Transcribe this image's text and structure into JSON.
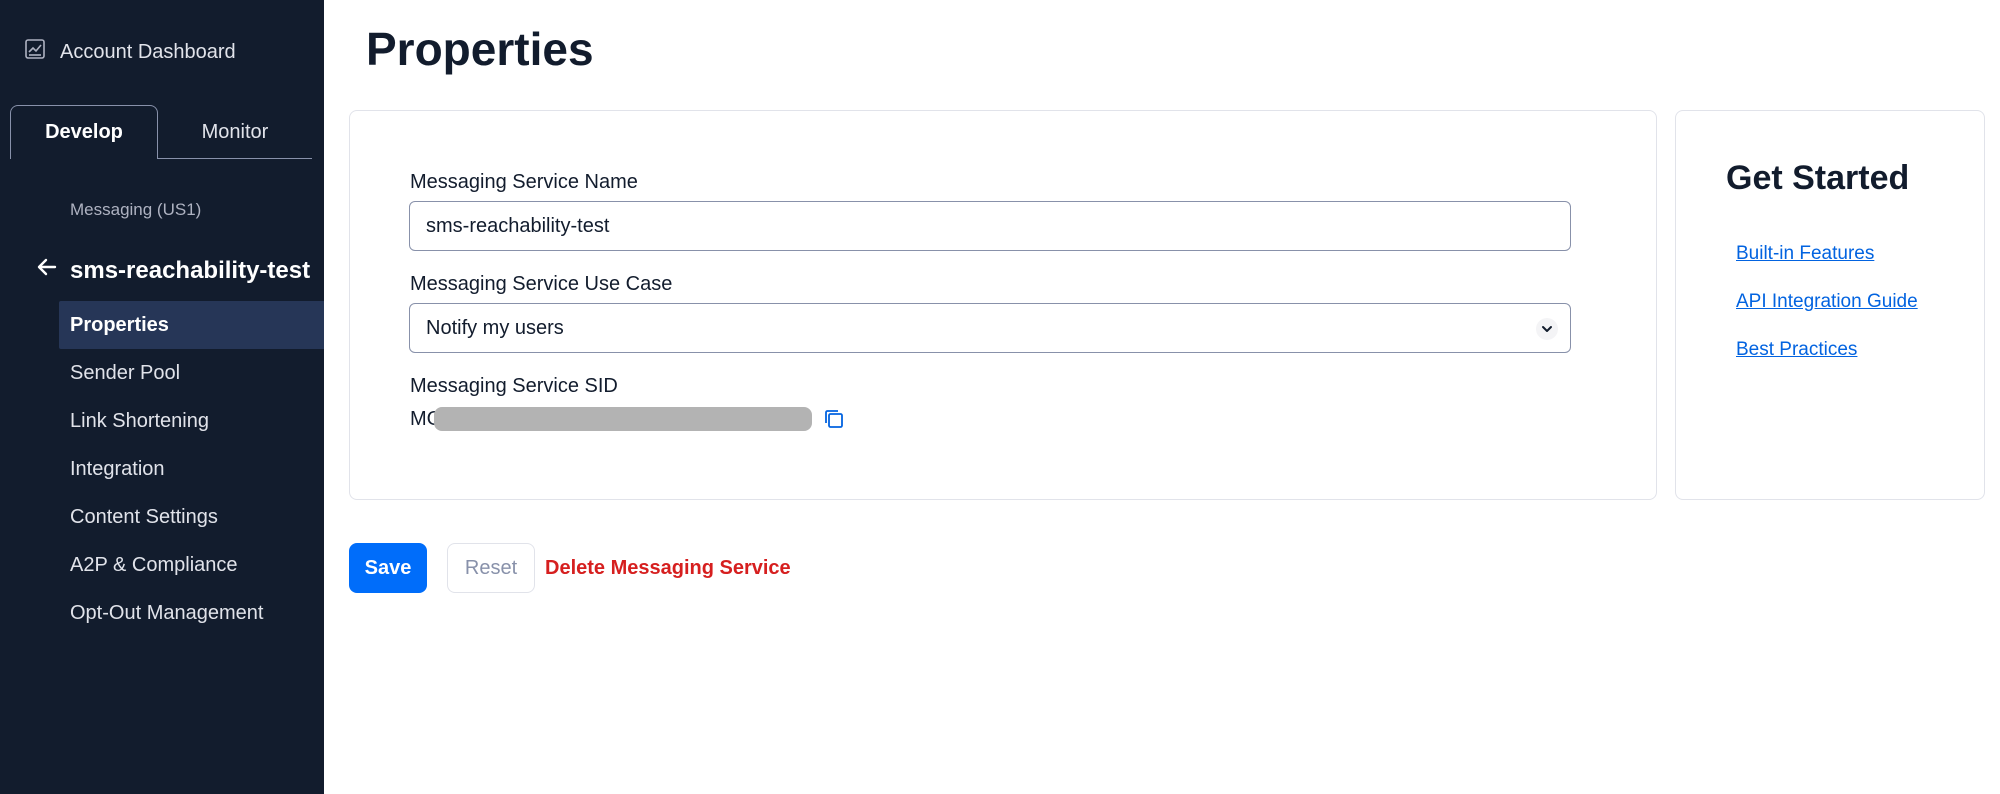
{
  "sidebar": {
    "account_dashboard": "Account Dashboard",
    "tabs": [
      {
        "label": "Develop",
        "active": true
      },
      {
        "label": "Monitor",
        "active": false
      }
    ],
    "breadcrumb": "Messaging (US1)",
    "service_name": "sms-reachability-test",
    "nav": [
      {
        "label": "Properties",
        "active": true
      },
      {
        "label": "Sender Pool"
      },
      {
        "label": "Link Shortening"
      },
      {
        "label": "Integration"
      },
      {
        "label": "Content Settings"
      },
      {
        "label": "A2P & Compliance"
      },
      {
        "label": "Opt-Out Management"
      }
    ]
  },
  "page": {
    "title": "Properties"
  },
  "form": {
    "name_label": "Messaging Service Name",
    "name_value": "sms-reachability-test",
    "use_case_label": "Messaging Service Use Case",
    "use_case_value": "Notify my users",
    "sid_label": "Messaging Service SID",
    "sid_prefix": "MG"
  },
  "get_started": {
    "title": "Get Started",
    "links": [
      "Built-in Features",
      "API Integration Guide",
      "Best Practices"
    ]
  },
  "actions": {
    "save": "Save",
    "reset": "Reset",
    "delete": "Delete Messaging Service"
  },
  "colors": {
    "sidebar_bg": "#121c2d",
    "primary": "#006dfa",
    "link": "#0263e0",
    "danger": "#d61f1f"
  }
}
